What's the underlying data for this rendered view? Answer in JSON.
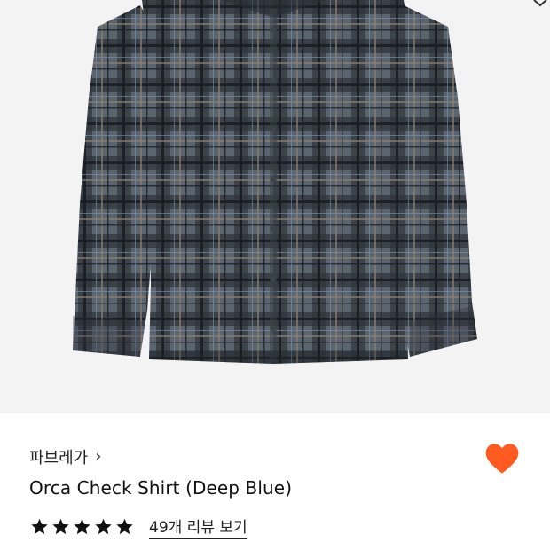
{
  "product": {
    "brand_label": "파브레가",
    "title": "Orca Check Shirt (Deep Blue)",
    "review_link_label": "49개 리뷰 보기",
    "star_rating": 5,
    "star_max": 5
  },
  "colors": {
    "heart": "#ff5a1f",
    "image_background": "#f3f3f3",
    "text_primary": "#111111"
  },
  "icons": {
    "favorite": "heart-icon",
    "brand_arrow": "chevron-right-icon",
    "star": "star-icon"
  }
}
